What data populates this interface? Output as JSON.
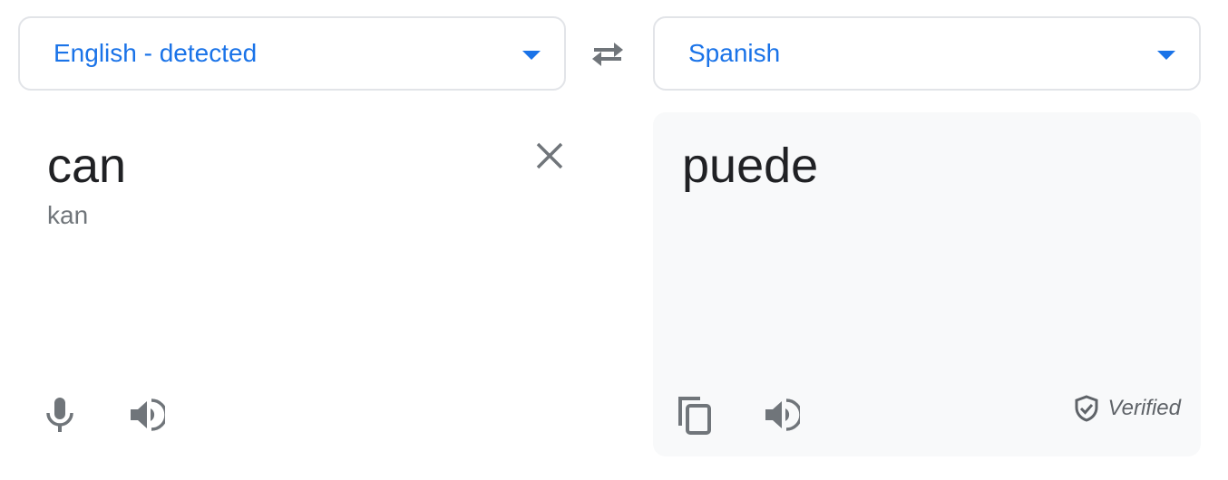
{
  "source_language": {
    "label": "English - detected",
    "icon": "chevron-down-icon"
  },
  "swap_button": {
    "icon": "swap-arrows-icon"
  },
  "target_language": {
    "label": "Spanish",
    "icon": "chevron-down-icon"
  },
  "source_panel": {
    "text": "can",
    "transliteration": "kan",
    "clear_icon": "close-icon",
    "mic_icon": "microphone-icon",
    "listen_icon": "speaker-icon"
  },
  "target_panel": {
    "text": "puede",
    "copy_icon": "copy-icon",
    "listen_icon": "speaker-icon",
    "verified_label": "Verified",
    "verified_icon": "shield-check-icon"
  },
  "colors": {
    "accent": "#1a73e8",
    "icon": "#70757a",
    "panel_bg": "#f8f9fa"
  }
}
